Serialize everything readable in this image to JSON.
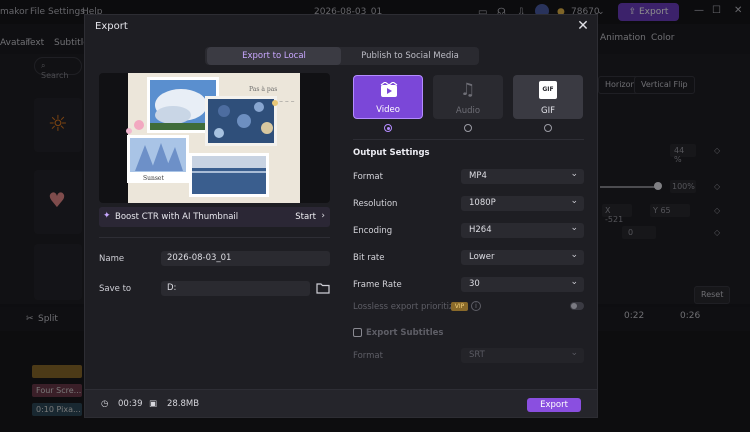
{
  "app": {
    "brand_fragment": "makor",
    "menu": [
      "File",
      "Settings",
      "Help"
    ],
    "project_name": "2026-08-03_01",
    "credits": "78670",
    "export_label": "Export",
    "tools": [
      "Avatar",
      "Text",
      "Subtitle"
    ],
    "right_tabs": [
      "Animation",
      "Color"
    ],
    "search_placeholder": "Search",
    "flip_horizontal": "Horizontal Flip",
    "flip_vertical": "Vertical Flip",
    "opacity_value": "44",
    "scale_value": "100%",
    "pos_x": "-521",
    "pos_y": "65",
    "rotate_value": "0",
    "reset_label": "Reset",
    "split_label": "Split",
    "timeline_clips": [
      "Four Scre...",
      "0:10 Pixa..."
    ],
    "ruler_marks": [
      "0:22",
      "0:26"
    ]
  },
  "dialog": {
    "title": "Export",
    "tabs": [
      "Export to Local",
      "Publish to Social Media"
    ],
    "thumbnail_label": "Boost CTR with AI Thumbnail",
    "thumbnail_action": "Start",
    "preview_caption": "Sunset",
    "name_label": "Name",
    "name_value": "2026-08-03_01",
    "save_label": "Save to",
    "save_value": "D:",
    "types": [
      {
        "label": "Video",
        "icon": "film-icon",
        "selected": true
      },
      {
        "label": "Audio",
        "icon": "music-note-icon",
        "selected": false
      },
      {
        "label": "GIF",
        "icon": "gif-icon",
        "selected": false
      }
    ],
    "output_settings_title": "Output Settings",
    "settings": [
      {
        "label": "Format",
        "value": "MP4"
      },
      {
        "label": "Resolution",
        "value": "1080P"
      },
      {
        "label": "Encoding",
        "value": "H264"
      },
      {
        "label": "Bit rate",
        "value": "Lower"
      },
      {
        "label": "Frame Rate",
        "value": "30"
      }
    ],
    "lossless_label": "Lossless export prioritized",
    "vip_badge": "VIP",
    "subtitles_label": "Export Subtitles",
    "subtitle_format_label": "Format",
    "subtitle_format_value": "SRT",
    "duration": "00:39",
    "file_size": "28.8MB",
    "export_button": "Export",
    "accent": "#8a4fe0"
  }
}
